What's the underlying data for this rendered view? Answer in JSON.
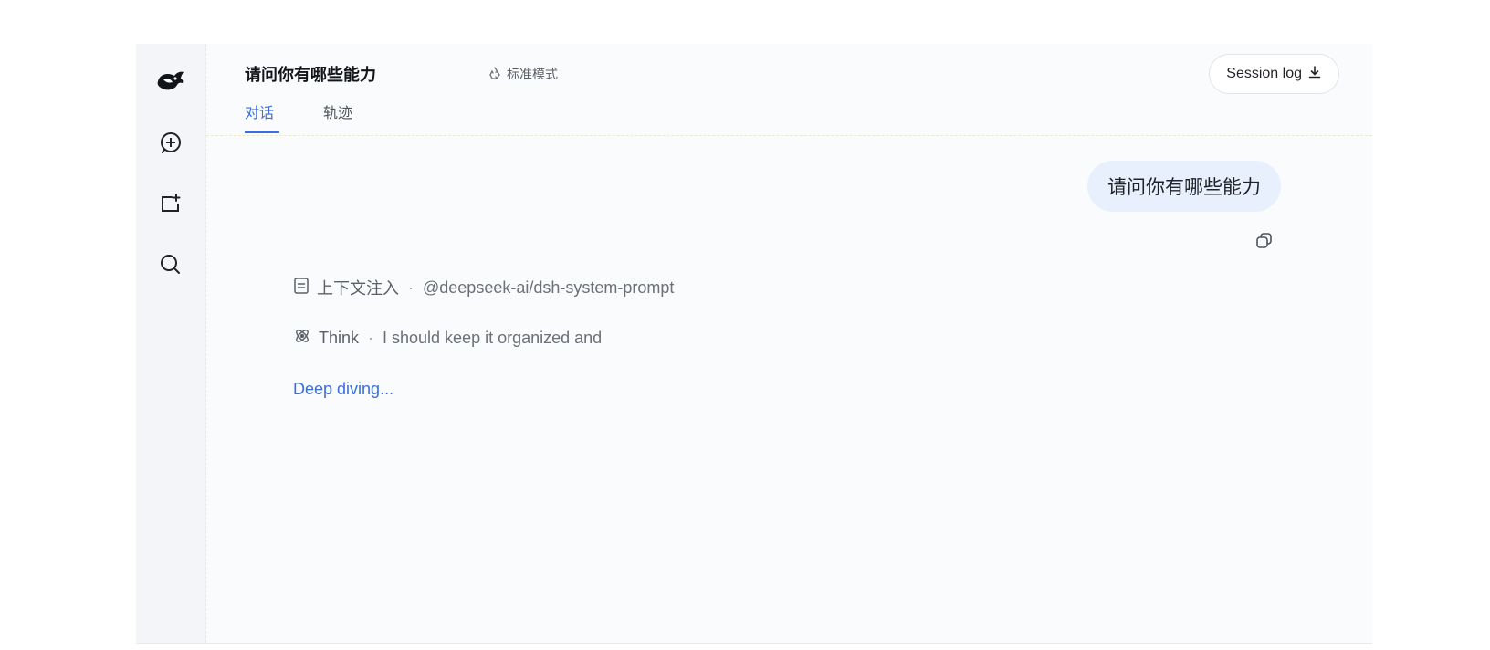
{
  "sidebar": {
    "logo": "whale-logo-icon",
    "items": [
      {
        "icon": "new-chat-icon"
      },
      {
        "icon": "new-folder-icon"
      },
      {
        "icon": "search-icon"
      }
    ]
  },
  "header": {
    "title": "请问你有哪些能力",
    "mode_label": "标准模式",
    "tabs": [
      {
        "label": "对话",
        "active": true
      },
      {
        "label": "轨迹",
        "active": false
      }
    ],
    "session_log_label": "Session log"
  },
  "conversation": {
    "user_message": "请问你有哪些能力",
    "steps": [
      {
        "icon": "document-icon",
        "label": "上下文注入",
        "separator": "·",
        "detail": "@deepseek-ai/dsh-system-prompt"
      },
      {
        "icon": "think-icon",
        "label": "Think",
        "separator": "·",
        "detail": "I should keep it organized and"
      }
    ],
    "status_text": "Deep diving..."
  },
  "colors": {
    "accent": "#3b6fe0",
    "bubble": "#e8f0fd",
    "sidebar_bg": "#f4f5f8",
    "main_bg": "#fafbfd"
  }
}
